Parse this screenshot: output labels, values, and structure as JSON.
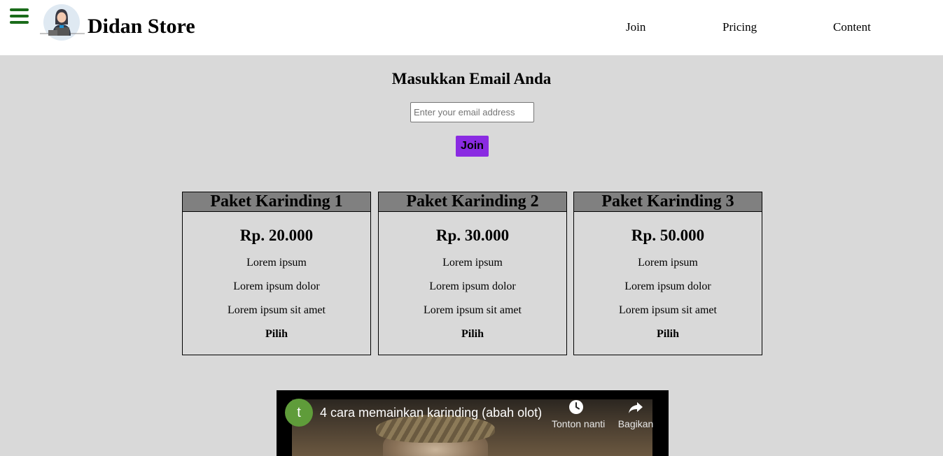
{
  "header": {
    "brand": "Didan Store",
    "nav": [
      {
        "label": "Join"
      },
      {
        "label": "Pricing"
      },
      {
        "label": "Content"
      }
    ]
  },
  "signup": {
    "title": "Masukkan Email Anda",
    "email_placeholder": "Enter your email address",
    "email_value": "",
    "join_label": "Join"
  },
  "pricing": {
    "cards": [
      {
        "name": "Paket Karinding 1",
        "price": "Rp. 20.000",
        "features": [
          "Lorem ipsum",
          "Lorem ipsum dolor",
          "Lorem ipsum sit amet"
        ],
        "select_label": "Pilih"
      },
      {
        "name": "Paket Karinding 2",
        "price": "Rp. 30.000",
        "features": [
          "Lorem ipsum",
          "Lorem ipsum dolor",
          "Lorem ipsum sit amet"
        ],
        "select_label": "Pilih"
      },
      {
        "name": "Paket Karinding 3",
        "price": "Rp. 50.000",
        "features": [
          "Lorem ipsum",
          "Lorem ipsum dolor",
          "Lorem ipsum sit amet"
        ],
        "select_label": "Pilih"
      }
    ]
  },
  "video": {
    "channel_initial": "t",
    "title": "4 cara memainkan karinding (abah olot)",
    "watch_later_label": "Tonton nanti",
    "share_label": "Bagikan"
  },
  "colors": {
    "background": "#d9d9d9",
    "header_bg": "#ffffff",
    "menu_icon": "#1a6b1a",
    "join_button": "#8a2be2",
    "card_header": "#808080",
    "channel_avatar": "#5f9c3a"
  },
  "icons": {
    "menu": "hamburger-menu-icon",
    "watch_later": "clock-icon",
    "share": "share-arrow-icon"
  }
}
